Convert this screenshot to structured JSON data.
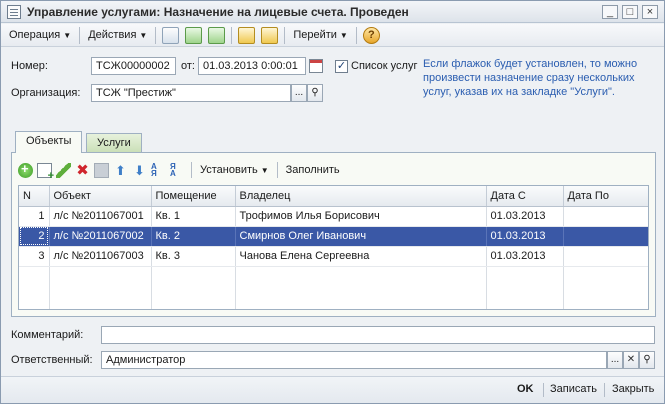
{
  "window": {
    "title": "Управление услугами: Назначение на лицевые счета. Проведен",
    "minimize": "_",
    "maximize": "□",
    "close": "×"
  },
  "toolbar": {
    "operation": "Операция",
    "actions": "Действия",
    "goto": "Перейти",
    "help": "?",
    "icons": [
      "doc-post-icon",
      "refresh-icon",
      "add-doc-icon",
      "move-doc-icon",
      "doc-structure-icon",
      "help-icon"
    ]
  },
  "form": {
    "number_label": "Номер:",
    "number_value": "ТСЖ00000002",
    "date_label": "от:",
    "date_value": "01.03.2013  0:00:01",
    "services_list_label": "Список услуг",
    "services_list_checked": true,
    "services_list_mark": "✓",
    "org_label": "Организация:",
    "org_value": "ТСЖ \"Престиж\"",
    "select_btn": "...",
    "open_btn": "⚲",
    "hint_lines": [
      "Если флажок будет установлен, то можно",
      "произвести назначение сразу нескольких",
      "услуг, указав их на закладке \"Услуги\"."
    ]
  },
  "tabs": [
    {
      "label": "Объекты",
      "active": true
    },
    {
      "label": "Услуги",
      "active": false
    }
  ],
  "grid_toolbar": {
    "set_label": "Установить",
    "fill_label": "Заполнить",
    "sort_az": "А\nЯ",
    "sort_za": "Я\nА",
    "delete": "✖",
    "up": "⬆",
    "down": "⬇"
  },
  "table": {
    "columns": [
      "N",
      "Объект",
      "Помещение",
      "Владелец",
      "Дата С",
      "Дата По"
    ],
    "rows": [
      {
        "n": "1",
        "object": "л/с №2011067001",
        "room": "Кв. 1",
        "owner": "Трофимов Илья Борисович",
        "date_from": "01.03.2013",
        "date_to": ""
      },
      {
        "n": "2",
        "object": "л/с №2011067002",
        "room": "Кв. 2",
        "owner": "Смирнов Олег Иванович",
        "date_from": "01.03.2013",
        "date_to": ""
      },
      {
        "n": "3",
        "object": "л/с №2011067003",
        "room": "Кв. 3",
        "owner": "Чанова Елена Сергеевна",
        "date_from": "01.03.2013",
        "date_to": ""
      }
    ]
  },
  "footer_fields": {
    "comment_label": "Комментарий:",
    "comment_value": "",
    "responsible_label": "Ответственный:",
    "responsible_value": "Администратор",
    "clear_btn": "✕"
  },
  "buttons": {
    "ok": "OK",
    "save": "Записать",
    "close": "Закрыть"
  }
}
